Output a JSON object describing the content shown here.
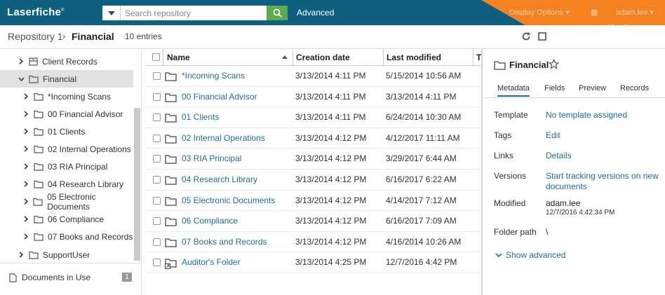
{
  "app": {
    "logo": "Laserfiche",
    "logo_mark": "®"
  },
  "search": {
    "placeholder": "Search repository",
    "advanced_label": "Advanced"
  },
  "top_right": {
    "display_options": "Display Options",
    "user": "adam.lee"
  },
  "promo": {
    "brand": "Laserfiche"
  },
  "breadcrumb": {
    "root": "Repository 1",
    "separator": "›",
    "current": "Financial",
    "entries": "10 entries"
  },
  "tree": {
    "items": [
      {
        "label": "Client Records",
        "level": 0,
        "expanded": false,
        "type": "cabinet"
      },
      {
        "label": "Financial",
        "level": 0,
        "expanded": true,
        "selected": true,
        "type": "folder-open"
      },
      {
        "label": "*Incoming Scans",
        "level": 1,
        "expanded": false,
        "type": "folder"
      },
      {
        "label": "00 Financial Advisor",
        "level": 1,
        "expanded": false,
        "type": "folder"
      },
      {
        "label": "01 Clients",
        "level": 1,
        "expanded": false,
        "type": "folder"
      },
      {
        "label": "02 Internal Operations",
        "level": 1,
        "expanded": false,
        "type": "folder"
      },
      {
        "label": "03 RIA Principal",
        "level": 1,
        "expanded": false,
        "type": "folder"
      },
      {
        "label": "04 Research Library",
        "level": 1,
        "expanded": false,
        "type": "folder"
      },
      {
        "label": "05 Electronic Documents",
        "level": 1,
        "expanded": false,
        "type": "folder"
      },
      {
        "label": "06 Compliance",
        "level": 1,
        "expanded": false,
        "type": "folder"
      },
      {
        "label": "07 Books and Records",
        "level": 1,
        "expanded": false,
        "type": "folder"
      },
      {
        "label": "SupportUser",
        "level": 0,
        "expanded": false,
        "type": "folder"
      }
    ],
    "docs_in_use": {
      "label": "Documents in Use",
      "count": "1"
    }
  },
  "grid": {
    "columns": {
      "name": "Name",
      "created": "Creation date",
      "modified": "Last modified",
      "extra": "T"
    },
    "rows": [
      {
        "name": "*Incoming Scans",
        "created": "3/13/2014 4:11 PM",
        "modified": "5/15/2014 10:56 AM"
      },
      {
        "name": "00 Financial Advisor",
        "created": "3/13/2014 4:11 PM",
        "modified": "3/13/2014 4:11 PM"
      },
      {
        "name": "01 Clients",
        "created": "3/13/2014 4:11 PM",
        "modified": "6/24/2014 10:30 AM"
      },
      {
        "name": "02 Internal Operations",
        "created": "3/13/2014 4:12 PM",
        "modified": "4/12/2017 11:11 AM"
      },
      {
        "name": "03 RIA Principal",
        "created": "3/13/2014 4:12 PM",
        "modified": "3/29/2017 6:44 AM"
      },
      {
        "name": "04 Research Library",
        "created": "3/13/2014 4:12 PM",
        "modified": "6/16/2017 6:22 AM"
      },
      {
        "name": "05 Electronic Documents",
        "created": "3/13/2014 4:12 PM",
        "modified": "4/14/2017 7:12 AM"
      },
      {
        "name": "06 Compliance",
        "created": "3/13/2014 4:12 PM",
        "modified": "6/16/2017 7:09 AM"
      },
      {
        "name": "07 Books and Records",
        "created": "3/13/2014 4:12 PM",
        "modified": "4/16/2014 10:26 AM"
      },
      {
        "name": "Auditor's Folder",
        "created": "3/13/2014 4:25 PM",
        "modified": "12/7/2016 4:42 PM",
        "shortcut": true
      }
    ]
  },
  "panel": {
    "title": "Financial",
    "tabs": [
      "Metadata",
      "Fields",
      "Preview",
      "Records"
    ],
    "active_tab": "Metadata",
    "template_label": "Template",
    "template_value": "No template assigned",
    "tags_label": "Tags",
    "tags_value": "Edit",
    "links_label": "Links",
    "links_value": "Details",
    "versions_label": "Versions",
    "versions_value_1": "Start tracking versions on new",
    "versions_value_2": "documents",
    "modified_label": "Modified",
    "modified_user": "adam.lee",
    "modified_date": "12/7/2016 4:42:34 PM",
    "path_label": "Folder path",
    "path_value": "\\",
    "show_advanced": "Show advanced"
  },
  "colors": {
    "topbar": "#0f5f7e",
    "accent_orange": "#f58220",
    "link": "#1f6f95",
    "search_btn": "#5aad4a"
  }
}
